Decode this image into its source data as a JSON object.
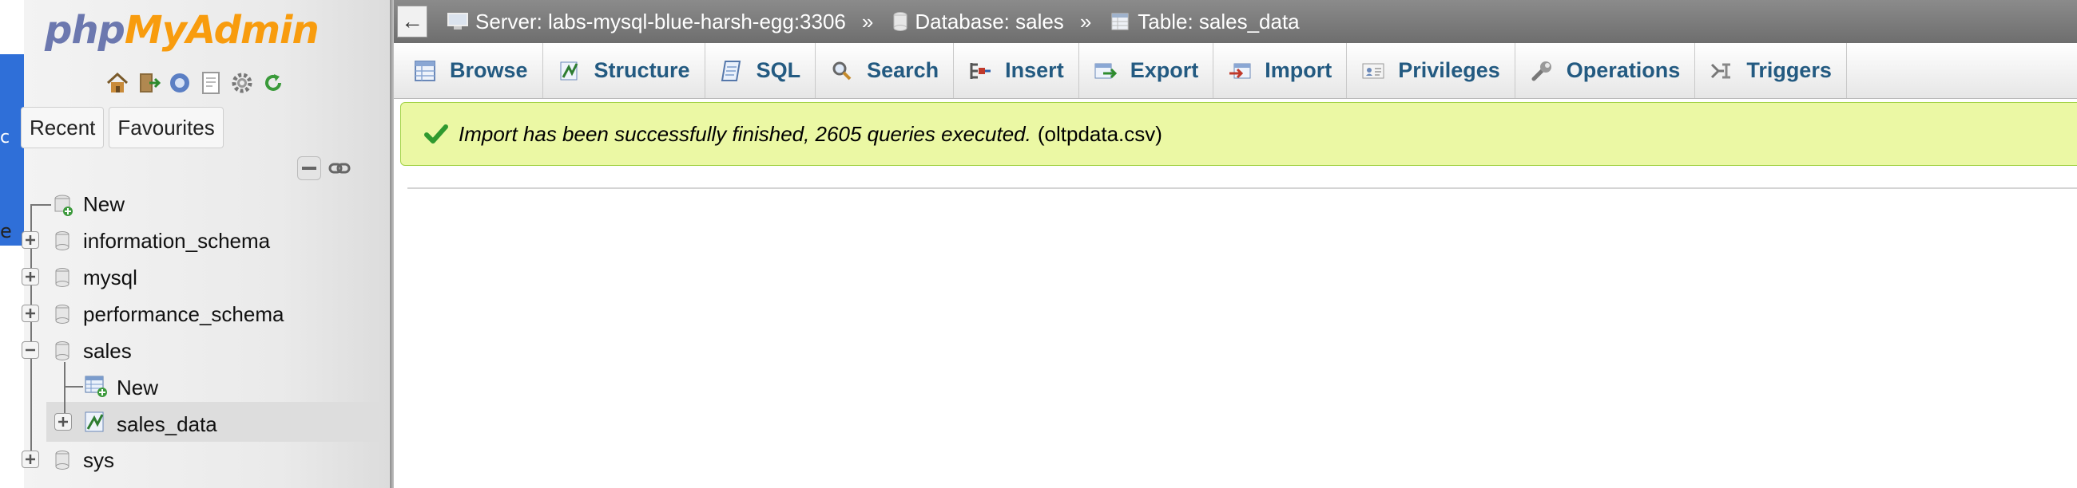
{
  "logo": {
    "part1": "php",
    "part2": "MyAdmin"
  },
  "nav_tabs": {
    "recent": "Recent",
    "favourites": "Favourites"
  },
  "nav_icons": [
    "home-icon",
    "logout-icon",
    "help-icon",
    "docs-icon",
    "settings-icon",
    "reload-icon"
  ],
  "tree": {
    "new_root": "New",
    "databases": {
      "information_schema": "information_schema",
      "mysql": "mysql",
      "performance_schema": "performance_schema",
      "sales": "sales",
      "sys": "sys"
    },
    "sales_children": {
      "new": "New",
      "sales_data": "sales_data"
    }
  },
  "breadcrumb": {
    "back": "←",
    "server": "Server: labs-mysql-blue-harsh-egg:3306",
    "database": "Database: sales",
    "table": "Table: sales_data",
    "separator": "»"
  },
  "menu": {
    "browse": "Browse",
    "structure": "Structure",
    "sql": "SQL",
    "search": "Search",
    "insert": "Insert",
    "export": "Export",
    "import": "Import",
    "privileges": "Privileges",
    "operations": "Operations",
    "triggers": "Triggers"
  },
  "message": {
    "text": "Import has been successfully finished, 2605 queries executed.",
    "file": "(oltpdata.csv)"
  },
  "underlying_window": {
    "char1": "c",
    "char2": "e"
  },
  "colors": {
    "link": "#235a81",
    "success_bg": "#ebf8a4",
    "success_border": "#a2d246",
    "topbar": "#7d7d7d",
    "logo_php": "#6c78af",
    "logo_myadmin": "#f89c0e"
  }
}
